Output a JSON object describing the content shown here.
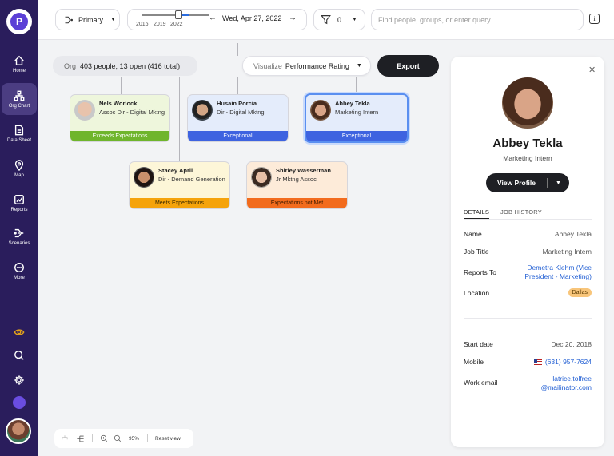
{
  "sidebar": {
    "logo_text": "P",
    "items": [
      {
        "label": "Home",
        "icon": "home-icon"
      },
      {
        "label": "Org Chart",
        "icon": "org-chart-icon",
        "active": true
      },
      {
        "label": "Data Sheet",
        "icon": "data-sheet-icon"
      },
      {
        "label": "Map",
        "icon": "map-pin-icon"
      },
      {
        "label": "Reports",
        "icon": "reports-icon"
      },
      {
        "label": "Scenarios",
        "icon": "scenarios-icon"
      },
      {
        "label": "More",
        "icon": "more-icon"
      }
    ],
    "bottom_icons": [
      "eye-icon",
      "search-icon",
      "gear-icon",
      "brand-icon"
    ],
    "accent_eye": "#e3a21a"
  },
  "topbar": {
    "view_label": "Primary",
    "years": [
      "2016",
      "2019",
      "2022"
    ],
    "date_label": "Wed, Apr 27, 2022",
    "filter_count": "0",
    "search_placeholder": "Find people, groups, or enter query",
    "info_label": "i"
  },
  "toolbar": {
    "org_label": "Org",
    "org_summary": "403 people, 13 open (416 total)",
    "visualize_label": "Visualize",
    "visualize_value": "Performance Rating",
    "export_label": "Export"
  },
  "cards": [
    {
      "name": "Nels Worlock",
      "role": "Assoc Dir - Digital Mktng",
      "rating": "Exceeds Expectations",
      "bg": "#eef6dc",
      "bar": "#6fb52c",
      "bar_text": "#ffffff"
    },
    {
      "name": "Husain Porcia",
      "role": "Dir - Digital Mktng",
      "rating": "Exceptional",
      "bg": "#e4ecfb",
      "bar": "#3e63e0",
      "bar_text": "#ffffff"
    },
    {
      "name": "Abbey Tekla",
      "role": "Marketing Intern",
      "rating": "Exceptional",
      "bg": "#e4ecfb",
      "bar": "#3e63e0",
      "bar_text": "#ffffff",
      "selected": true
    },
    {
      "name": "Stacey April",
      "role": "Dir - Demand Generation",
      "rating": "Meets Expectations",
      "bg": "#fdf6d8",
      "bar": "#f5a30b",
      "bar_text": "#3a2a00"
    },
    {
      "name": "Shirley Wasserman",
      "role": "Jr Mktng Assoc",
      "rating": "Expectations not Met",
      "bg": "#fdebd9",
      "bar": "#f26b1d",
      "bar_text": "#3a1a00"
    }
  ],
  "zoom": {
    "level": "95%",
    "reset_label": "Reset view"
  },
  "panel": {
    "name": "Abbey Tekla",
    "title": "Marketing Intern",
    "profile_button": "View Profile",
    "tabs": [
      "DETAILS",
      "JOB HISTORY"
    ],
    "fields": {
      "name_label": "Name",
      "name_value": "Abbey Tekla",
      "job_label": "Job Title",
      "job_value": "Marketing Intern",
      "reports_label": "Reports To",
      "reports_value_1": "Demetra Klehm (Vice",
      "reports_value_2": "President - Marketing)",
      "location_label": "Location",
      "location_value": "Dallas",
      "start_label": "Start date",
      "start_value": "Dec 20, 2018",
      "mobile_label": "Mobile",
      "mobile_value": "(631) 957-7624",
      "email_label": "Work email",
      "email_value_1": "latrice.tolfree",
      "email_value_2": "@mailinator.com"
    }
  }
}
